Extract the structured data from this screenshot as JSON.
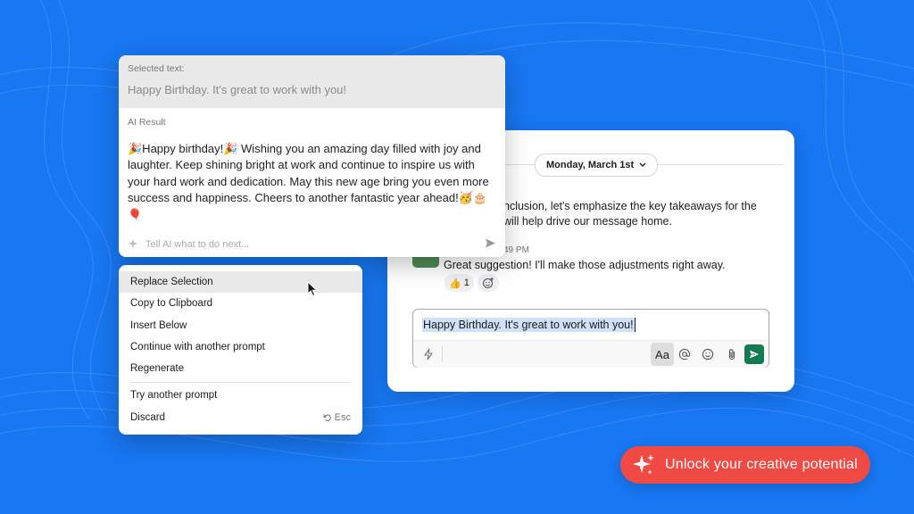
{
  "chat": {
    "date": "Monday, March 1st",
    "message1_line1": "nclusion, let's emphasize the key takeaways for the",
    "message1_line2": "will help drive our message home.",
    "message2_time": "49 PM",
    "message2_text": "Great suggestion! I'll make those adjustments right away.",
    "reaction_emoji": "👍",
    "reaction_count": "1",
    "composer_text": "Happy Birthday. It's great to work with you!",
    "aa_label": "Aa"
  },
  "ai_panel": {
    "selected_label": "Selected text:",
    "selected_text": "Happy Birthday. It's great to work with you!",
    "result_label": "AI Result",
    "result_text": "🎉Happy birthday!🎉 Wishing you an amazing day filled with joy and laughter. Keep shining bright at work and continue to inspire us with your hard work and dedication. May this new age bring you even more success and happiness. Cheers to another fantastic year ahead!🥳🎂🎈",
    "prompt_placeholder": "Tell AI what to do next..."
  },
  "menu": {
    "items": [
      {
        "label": "Replace Selection"
      },
      {
        "label": "Copy to Clipboard"
      },
      {
        "label": "Insert Below"
      },
      {
        "label": "Continue with another prompt"
      },
      {
        "label": "Regenerate"
      },
      {
        "label": "Try another prompt"
      },
      {
        "label": "Discard"
      }
    ],
    "discard_shortcut": "Esc"
  },
  "cta": {
    "label": "Unlock your creative potential"
  },
  "colors": {
    "background": "#1877f2",
    "cta": "#f04a44",
    "send": "#137a52",
    "selection_highlight": "#cfe0f7"
  }
}
